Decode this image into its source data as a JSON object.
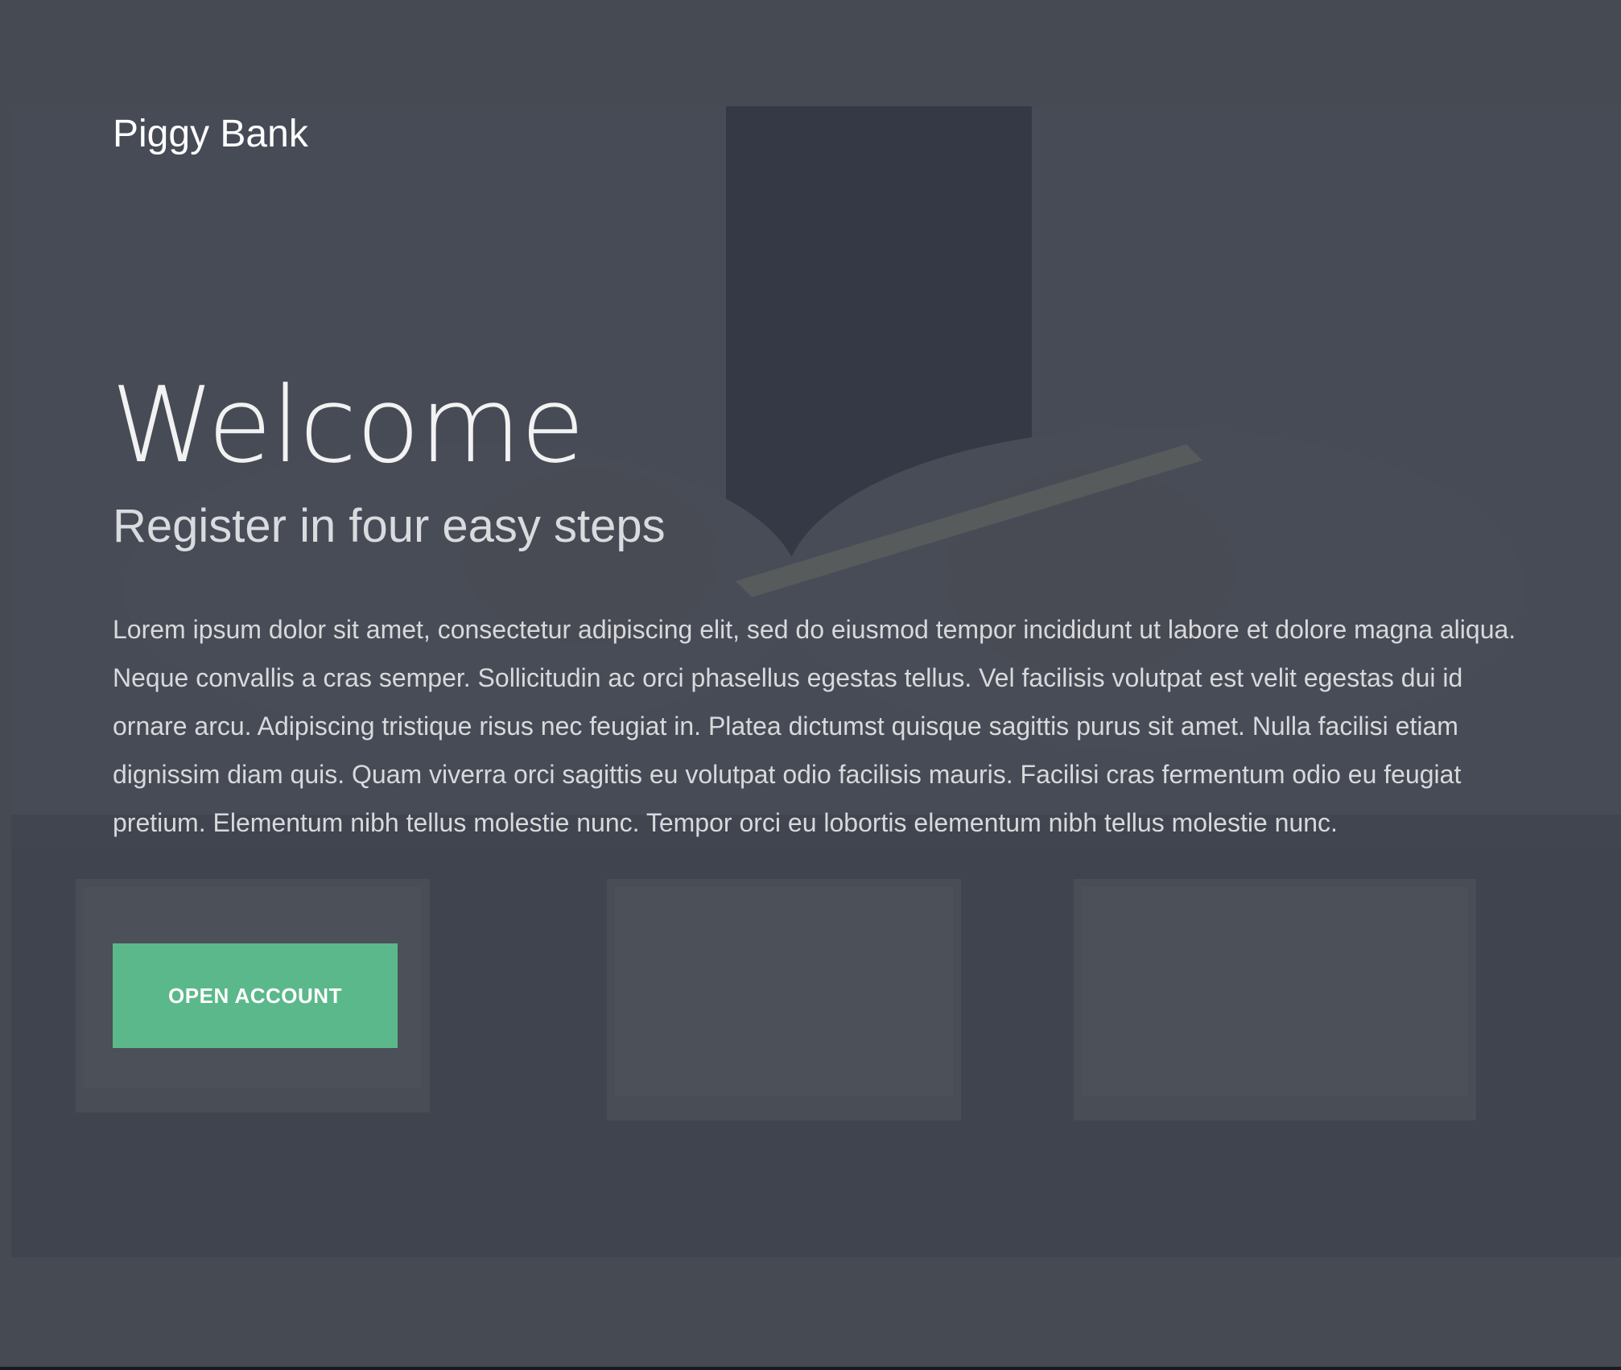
{
  "header": {
    "brand": "Piggy Bank"
  },
  "hero": {
    "title": "Welcome",
    "subtitle": "Register in four easy steps",
    "body": "Lorem ipsum dolor sit amet, consectetur adipiscing elit, sed do eiusmod tempor incididunt ut labore et dolore magna aliqua. Neque convallis a cras semper. Sollicitudin ac orci phasellus egestas tellus. Vel facilisis volutpat est velit egestas dui id ornare arcu. Adipiscing tristique risus nec feugiat in. Platea dictumst quisque sagittis purus sit amet. Nulla facilisi etiam dignissim diam quis. Quam viverra orci sagittis eu volutpat odio facilisis mauris. Facilisi cras fermentum odio eu feugiat pretium. Elementum nibh tellus molestie nunc. Tempor orci eu lobortis elementum nibh tellus molestie nunc.",
    "cta_label": "OPEN ACCOUNT"
  },
  "colors": {
    "page_background": "#464a52",
    "overlay": "#3d424c",
    "accent": "#5bb88a",
    "text": "#ffffff"
  }
}
